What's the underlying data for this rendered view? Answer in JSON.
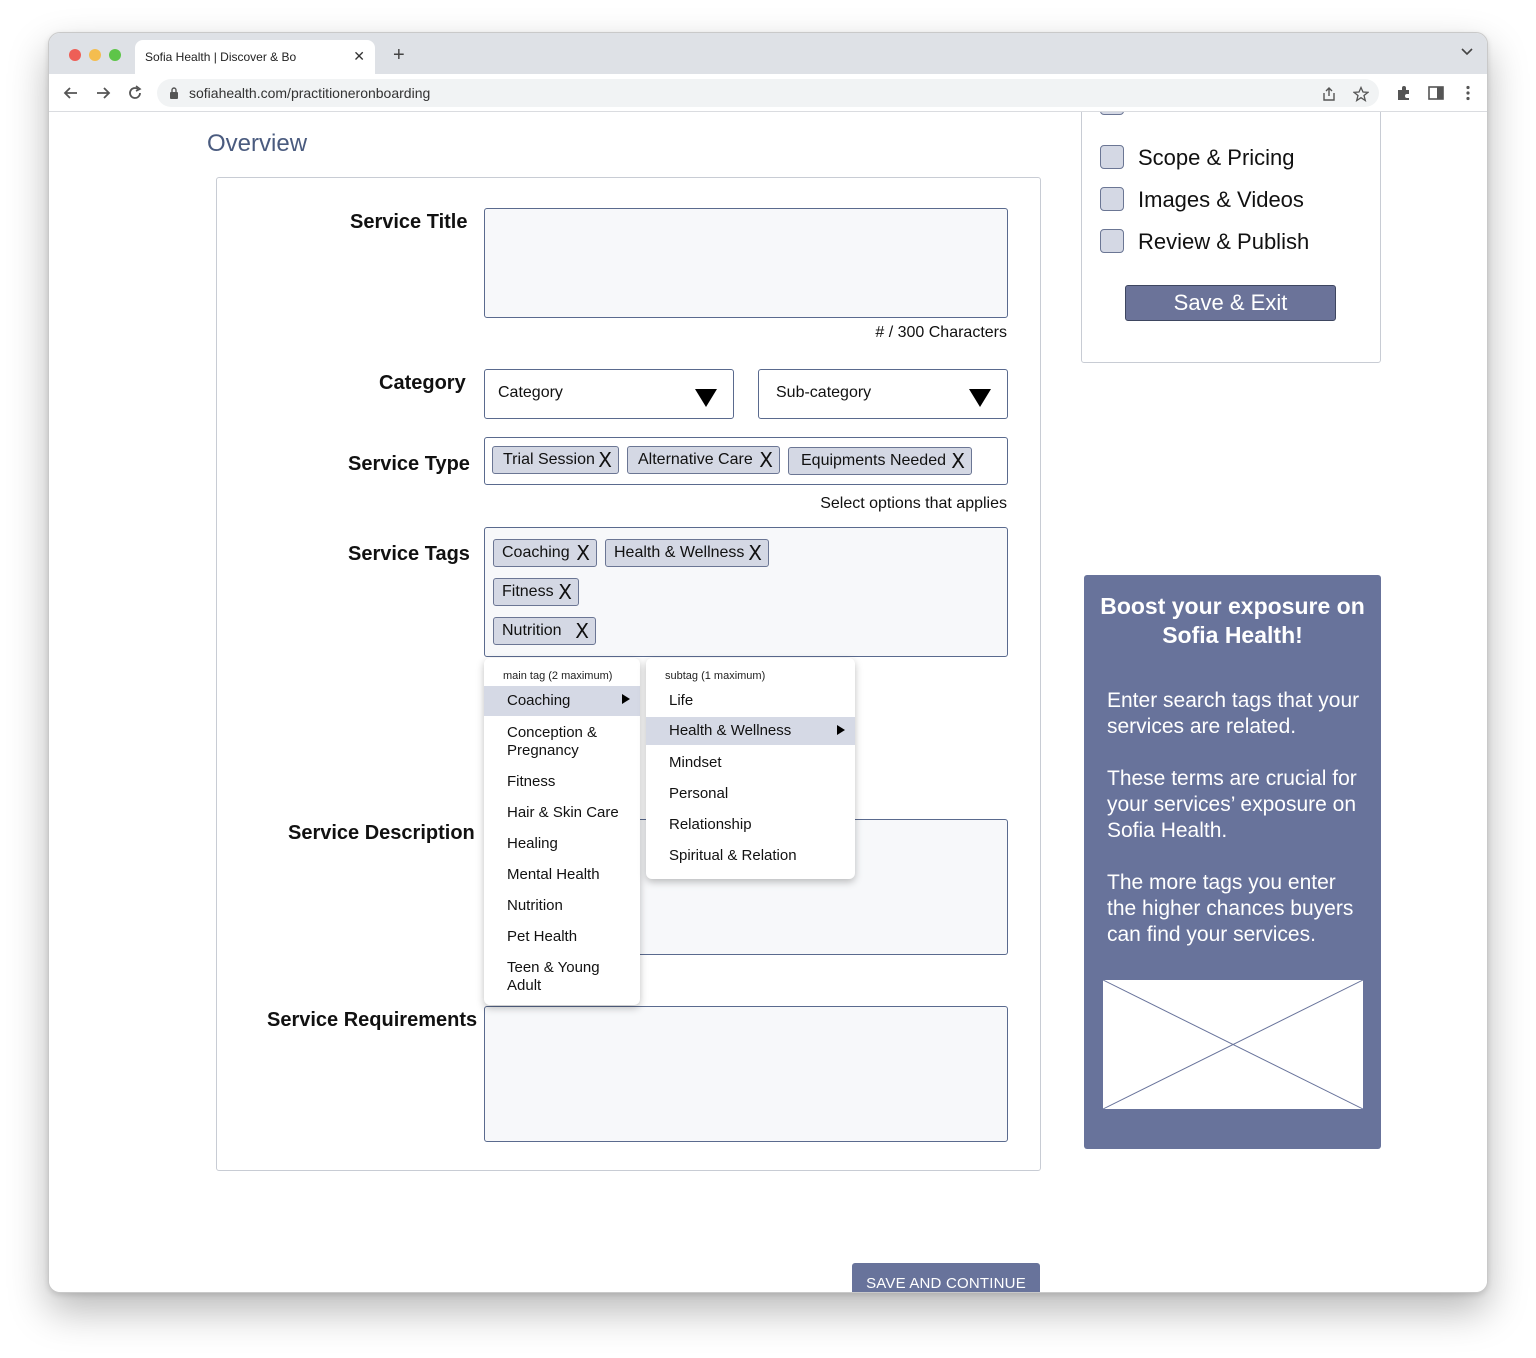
{
  "browser": {
    "tab_title": "Sofia Health | Discover & Bo",
    "url": "sofiahealth.com/practitioneronboarding"
  },
  "page": {
    "section_title": "Overview"
  },
  "form": {
    "service_title_label": "Service Title",
    "char_counter": "# / 300 Characters",
    "category_label": "Category",
    "category_placeholder": "Category",
    "subcategory_placeholder": "Sub-category",
    "service_type_label": "Service Type",
    "service_type_chips": [
      "Trial Session",
      "Alternative Care",
      "Equipments Needed"
    ],
    "service_type_helper": "Select options that applies",
    "service_tags_label": "Service Tags",
    "service_tag_chips": [
      "Coaching",
      "Health & Wellness",
      "Fitness",
      "Nutrition"
    ],
    "service_description_label": "Service Description",
    "service_requirements_label": "Service Requirements",
    "chip_remove_glyph": "X"
  },
  "tag_menu": {
    "main_header": "main tag (2 maximum)",
    "main_items": [
      "Coaching",
      "Conception & Pregnancy",
      "Fitness",
      "Hair & Skin Care",
      "Healing",
      "Mental Health",
      "Nutrition",
      "Pet Health",
      "Teen & Young Adult"
    ],
    "main_active": "Coaching",
    "sub_header": "subtag (1 maximum)",
    "sub_items": [
      "Life",
      "Health & Wellness",
      "Mindset",
      "Personal",
      "Relationship",
      "Spiritual & Relation"
    ],
    "sub_active": "Health & Wellness"
  },
  "steps": {
    "items": [
      "Scope & Pricing",
      "Images & Videos",
      "Review & Publish"
    ],
    "save_exit": "Save & Exit"
  },
  "promo": {
    "title": "Boost your exposure on Sofia Health!",
    "p1": "Enter search tags that your services are related.",
    "p2": "These terms are crucial for your services’ exposure on Sofia Health.",
    "p3": "The more tags you enter the higher chances buyers can find your services."
  },
  "footer": {
    "continue_label": "SAVE AND CONTINUE"
  },
  "colors": {
    "accent": "#68739b",
    "title": "#4a5b7f",
    "chip_bg": "#d4d8e4"
  }
}
